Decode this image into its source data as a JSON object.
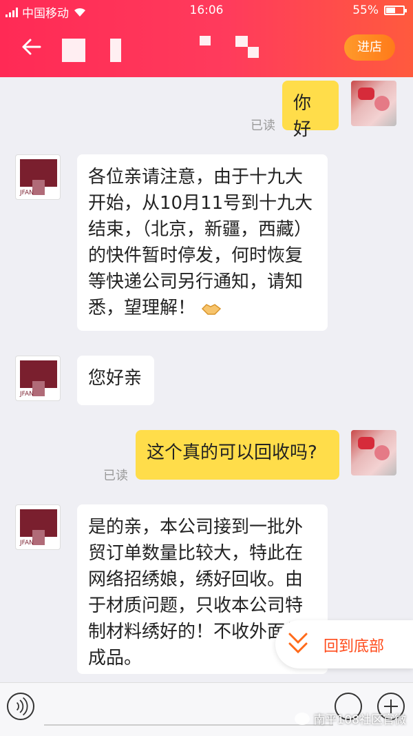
{
  "status_bar": {
    "carrier": "中国移动",
    "time": "16:06",
    "battery": "55%",
    "battery_level": 0.55
  },
  "header": {
    "shop_button": "进店"
  },
  "messages": [
    {
      "from": "me",
      "text": "你好",
      "read": "已读"
    },
    {
      "from": "shop",
      "text": "各位亲请注意，由于十九大开始，从10月11号到十九大结束，（北京，新疆，西藏）的快件暂时停发，何时恢复等快递公司另行通知，请知悉，望理解！",
      "emoji": "handshake-emoji"
    },
    {
      "from": "shop",
      "text": "您好亲"
    },
    {
      "from": "me",
      "text": "这个真的可以回收吗?",
      "read": "已读"
    },
    {
      "from": "shop",
      "text": "是的亲，本公司接到一批外贸订单数量比较大，特此在网络招绣娘，绣好回收。由于材质问题，只收本公司特制材料绣好的！不收外面的成品。"
    }
  ],
  "jump_button": "回到底部",
  "watermark": "南平108社区官微",
  "colors": {
    "header_start": "#ff2a55",
    "header_end": "#ff5a3e",
    "out_bubble": "#ffdd4a",
    "accent": "#ff4a1a"
  }
}
